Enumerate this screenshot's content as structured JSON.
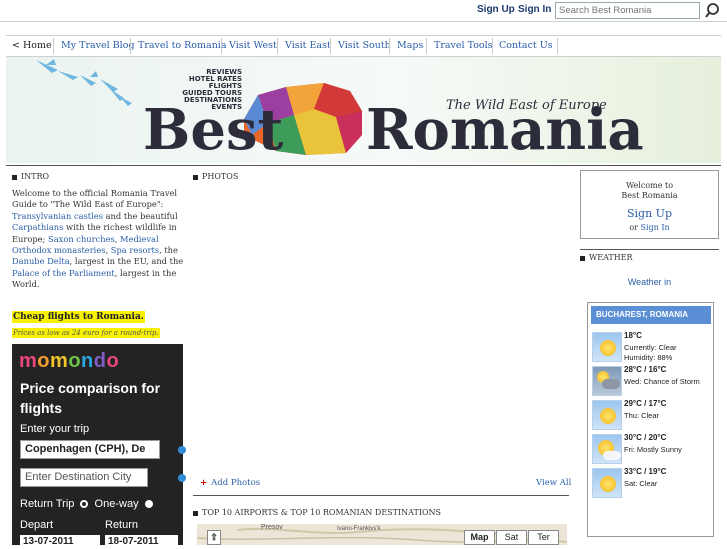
{
  "topbar": {
    "sign_up": "Sign Up",
    "sign_in": "Sign In",
    "search_placeholder": "Search Best Romania",
    "search_icon": "search-icon"
  },
  "nav": {
    "items": [
      {
        "label": "< Home"
      },
      {
        "label": "My Travel Blog"
      },
      {
        "label": "Travel to Romania"
      },
      {
        "label": "Visit West"
      },
      {
        "label": "Visit East"
      },
      {
        "label": "Visit South"
      },
      {
        "label": "Maps"
      },
      {
        "label": "Travel Tools"
      },
      {
        "label": "Contact Us"
      }
    ]
  },
  "banner": {
    "brand_left": "Best",
    "brand_right": "Romania",
    "tagline": "The Wild East of Europe",
    "stack": [
      "REVIEWS",
      "HOTEL RATES",
      "FLIGHTS",
      "GUIDED TOURS",
      "DESTINATIONS",
      "EVENTS"
    ]
  },
  "intro": {
    "section_title": "INTRO",
    "text_parts": [
      "Welcome to the official Romania Travel Guide to \"The Wild East of Europe\": ",
      "Transylvanian castles",
      " and the beautiful ",
      "Carpathians",
      " with the richest wildlife in Europe; ",
      "Saxon churches",
      ", ",
      "Medieval Orthodox monasteries",
      ", ",
      "Spa resorts",
      ", the ",
      "Danube Delta",
      ", largest in the EU, and the ",
      "Palace of the Parliament",
      ", largest in the World."
    ]
  },
  "flights": {
    "headline": "Cheap flights to Romania.",
    "subline": "Prices as low as 24 euro for a round-trip.",
    "widget": {
      "logo": "momondo",
      "title": "Price comparison for flights",
      "enter_trip": "Enter your trip",
      "origin_value": "Copenhagen (CPH), De",
      "destination_placeholder": "Enter Destination City",
      "return_trip": "Return Trip",
      "one_way": "One-way",
      "depart_label": "Depart",
      "return_label": "Return",
      "depart_value": "13-07-2011",
      "return_value": "18-07-2011"
    }
  },
  "photos": {
    "section_title": "PHOTOS",
    "add_photos": "Add Photos",
    "view_all": "View All"
  },
  "top10": {
    "section_title": "TOP 10 AIRPORTS & TOP 10 ROMANIAN DESTINATIONS",
    "map_labels": [
      "Presov",
      "Ivano-Frankivs'k"
    ],
    "map_buttons": [
      "Map",
      "Sat",
      "Ter"
    ]
  },
  "welcome": {
    "text_line1": "Welcome to",
    "text_line2": "Best Romania",
    "sign_up": "Sign Up",
    "or": "or",
    "sign_in": "Sign In"
  },
  "weather": {
    "section_title": "WEATHER",
    "weather_in": "Weather in",
    "location": "BUCHAREST, ROMANIA",
    "rows": [
      {
        "temp": "18°C",
        "line1": "Currently: Clear",
        "line2": "Humidity: 88%",
        "icon": "sun-icon"
      },
      {
        "temp": "28°C / 16°C",
        "line1": "Wed: Chance of Storm",
        "line2": "",
        "icon": "storm-icon"
      },
      {
        "temp": "29°C / 17°C",
        "line1": "Thu: Clear",
        "line2": "",
        "icon": "sun-icon"
      },
      {
        "temp": "30°C / 20°C",
        "line1": "Fri: Mostly Sunny",
        "line2": "",
        "icon": "sun-cloud-icon"
      },
      {
        "temp": "33°C / 19°C",
        "line1": "Sat: Clear",
        "line2": "",
        "icon": "sun-icon"
      }
    ]
  },
  "colors": {
    "link": "#2b5ea8",
    "highlight": "#f8f200",
    "weather_header": "#5a8fd6",
    "momondo_bg": "#232323"
  }
}
